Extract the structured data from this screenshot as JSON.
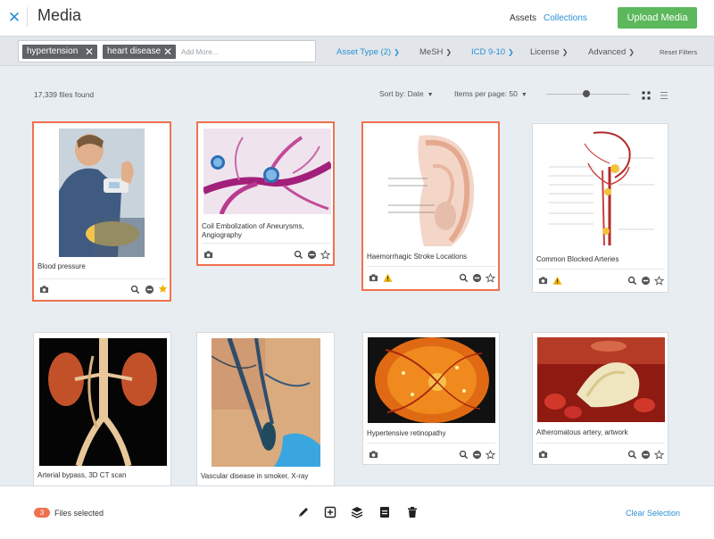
{
  "header": {
    "title": "Media",
    "nav": {
      "assets": "Assets",
      "collections": "Collections"
    },
    "upload_label": "Upload Media"
  },
  "filters": {
    "chips": [
      "hypertension",
      "heart disease"
    ],
    "placeholder": "Add More...",
    "asset_type": "Asset Type (2)",
    "mesh": "MeSH",
    "icd": "ICD 9-10",
    "license": "License",
    "advanced": "Advanced",
    "reset": "Reset Filters"
  },
  "toolbar": {
    "files_found": "17,339 files found",
    "sort_by": "Sort by: Date",
    "items_per_page": "Items per page: 50"
  },
  "cards": [
    {
      "title": "Blood pressure",
      "selected": true,
      "starred": true,
      "warning": false
    },
    {
      "title": "Coil Embolization of Aneurysms, Angiography",
      "selected": true,
      "starred": false,
      "warning": false
    },
    {
      "title": "Haemorrhagic Stroke Locations",
      "selected": true,
      "starred": false,
      "warning": true
    },
    {
      "title": "Common Blocked Arteries",
      "selected": false,
      "starred": false,
      "warning": true
    },
    {
      "title": "Arterial bypass, 3D CT scan",
      "selected": false,
      "starred": false,
      "warning": false
    },
    {
      "title": "Vascular disease in smoker, X-ray",
      "selected": false,
      "starred": false,
      "warning": false
    },
    {
      "title": "Hypertensive retinopathy",
      "selected": false,
      "starred": false,
      "warning": false
    },
    {
      "title": "Atheromatous artery, artwork",
      "selected": false,
      "starred": false,
      "warning": false
    }
  ],
  "selection": {
    "count": "3",
    "label": "Files selected",
    "clear": "Clear Selection"
  },
  "colors": {
    "accent": "#2b8fd6",
    "selected_border": "#f0714f",
    "upload_button": "#5cb85c",
    "star": "#f0b400",
    "warning": "#f0b400"
  }
}
